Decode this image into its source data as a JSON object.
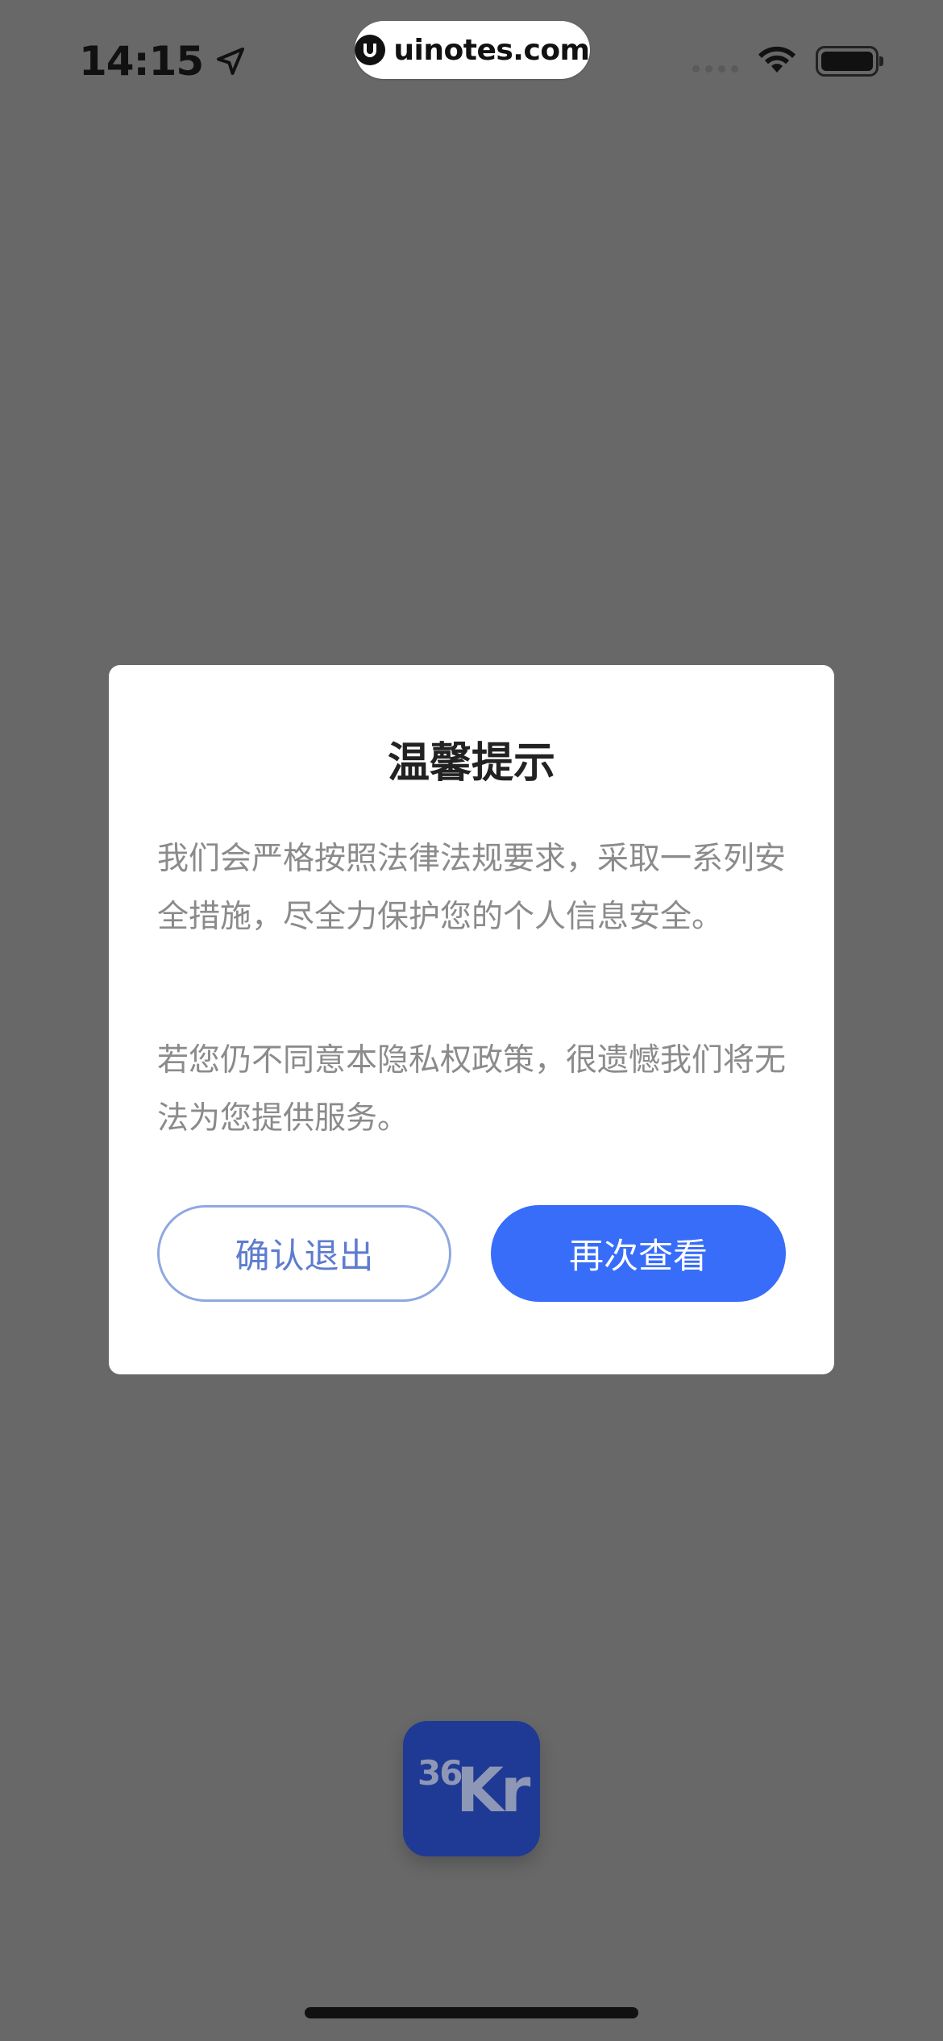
{
  "status_bar": {
    "time": "14:15",
    "url": "uinotes.com",
    "icons": [
      "location-arrow-icon",
      "signal-icon",
      "wifi-icon",
      "battery-icon"
    ]
  },
  "dialog": {
    "title": "温馨提示",
    "paragraph1": "我们会严格按照法律法规要求，采取一系列安全措施，尽全力保护您的个人信息安全。",
    "paragraph2": "若您仍不同意本隐私权政策，很遗憾我们将无法为您提供服务。",
    "exit_button": "确认退出",
    "review_button": "再次查看"
  },
  "app_logo": {
    "part1": "36",
    "part2": "Kr"
  },
  "colors": {
    "overlay": "#686868",
    "primary": "#386dfa",
    "outline": "#8fa8e0",
    "logo_bg": "#1f3a94"
  }
}
